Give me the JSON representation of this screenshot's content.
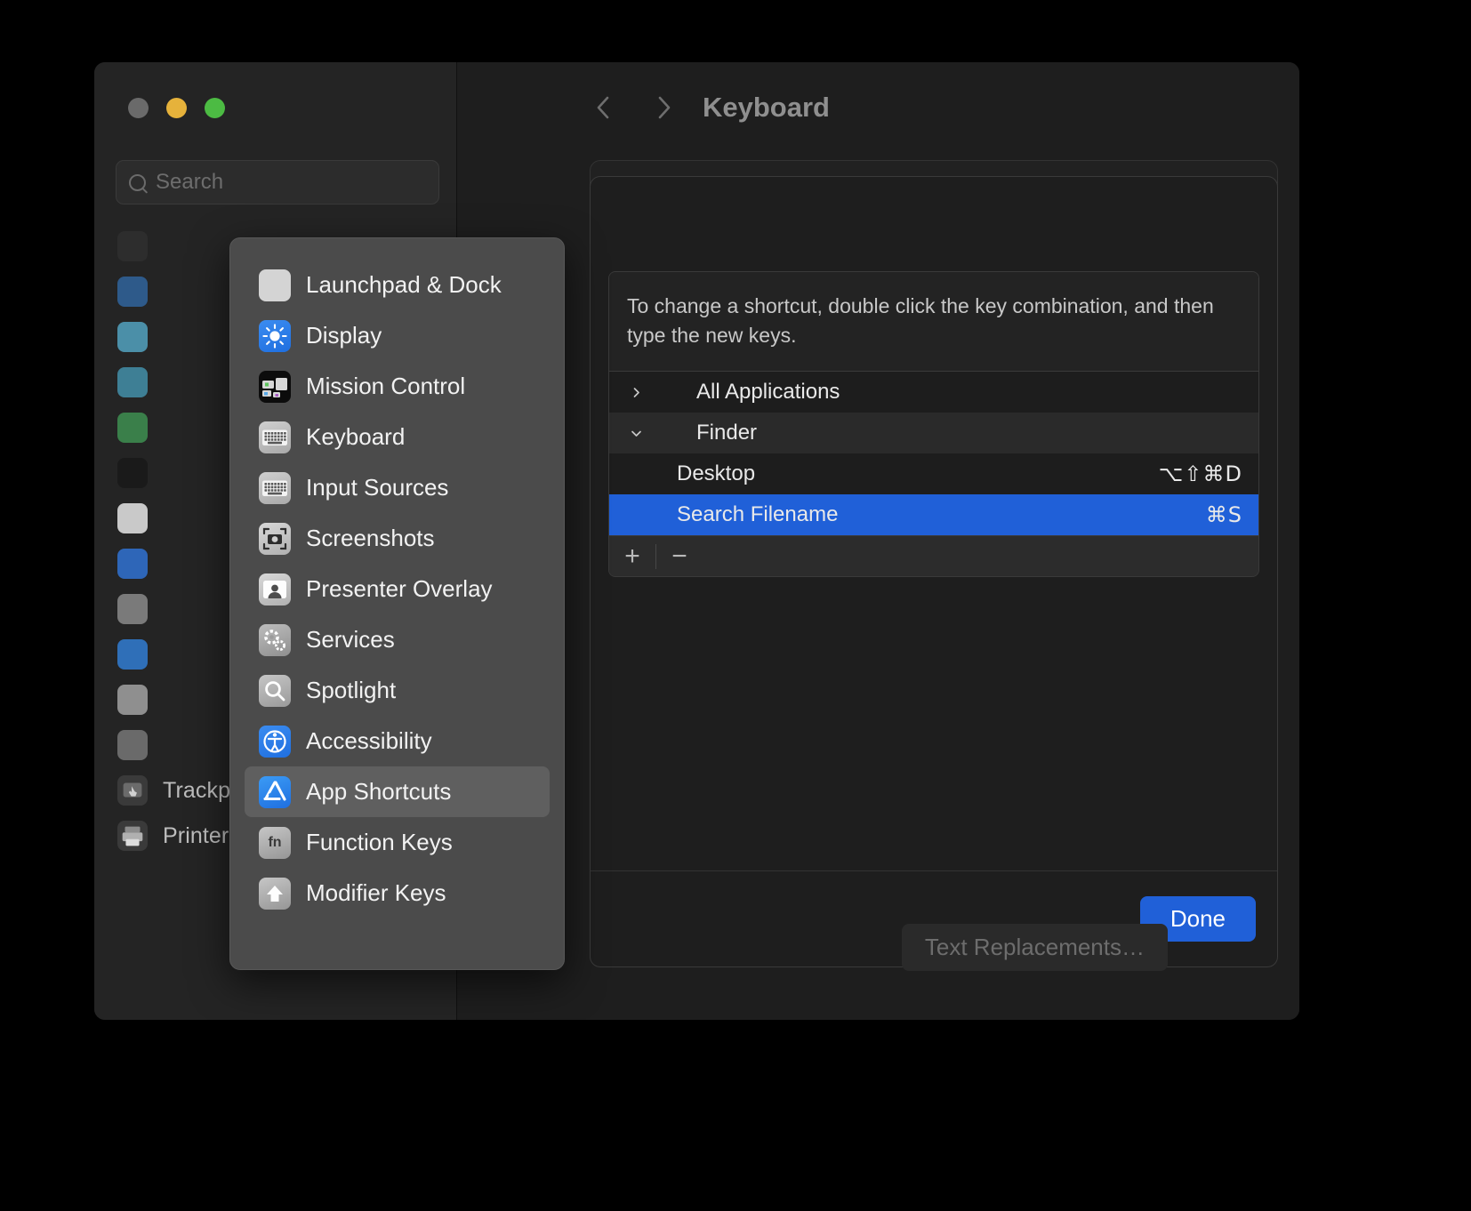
{
  "window": {
    "traffic_lights": [
      "close",
      "minimize",
      "maximize"
    ],
    "title": "Keyboard",
    "back_icon": "chevron-left-icon",
    "forward_icon": "chevron-right-icon"
  },
  "sidebar": {
    "search": {
      "placeholder": "Search",
      "value": "",
      "icon": "search-icon"
    },
    "hidden_items": [
      {
        "icon": "generic"
      },
      {
        "icon": "generic"
      },
      {
        "icon": "generic"
      },
      {
        "icon": "generic"
      },
      {
        "icon": "generic"
      },
      {
        "icon": "generic"
      },
      {
        "icon": "generic"
      },
      {
        "icon": "generic"
      },
      {
        "icon": "generic"
      },
      {
        "icon": "generic"
      },
      {
        "icon": "generic"
      },
      {
        "icon": "generic"
      }
    ],
    "items": [
      {
        "label": "Trackpad",
        "icon": "trackpad-icon"
      },
      {
        "label": "Printers & Scanners",
        "icon": "printer-icon"
      }
    ]
  },
  "popover": {
    "items": [
      {
        "label": "Launchpad & Dock",
        "icon": "launchpad-icon",
        "selected": false
      },
      {
        "label": "Display",
        "icon": "display-icon",
        "selected": false
      },
      {
        "label": "Mission Control",
        "icon": "mission-control-icon",
        "selected": false
      },
      {
        "label": "Keyboard",
        "icon": "keyboard-icon",
        "selected": false
      },
      {
        "label": "Input Sources",
        "icon": "input-sources-icon",
        "selected": false
      },
      {
        "label": "Screenshots",
        "icon": "screenshots-icon",
        "selected": false
      },
      {
        "label": "Presenter Overlay",
        "icon": "presenter-overlay-icon",
        "selected": false
      },
      {
        "label": "Services",
        "icon": "services-icon",
        "selected": false
      },
      {
        "label": "Spotlight",
        "icon": "spotlight-icon",
        "selected": false
      },
      {
        "label": "Accessibility",
        "icon": "accessibility-icon",
        "selected": false
      },
      {
        "label": "App Shortcuts",
        "icon": "app-shortcuts-icon",
        "selected": true
      },
      {
        "label": "Function Keys",
        "icon": "function-keys-icon",
        "selected": false
      },
      {
        "label": "Modifier Keys",
        "icon": "modifier-keys-icon",
        "selected": false
      }
    ]
  },
  "main": {
    "hint": "To change a shortcut, double click the key combination, and then type the new keys.",
    "rows": [
      {
        "type": "group",
        "label": "All Applications",
        "expanded": false,
        "disclosure": "chevron-right-icon",
        "keys": ""
      },
      {
        "type": "group",
        "label": "Finder",
        "expanded": true,
        "disclosure": "chevron-down-icon",
        "keys": ""
      },
      {
        "type": "child",
        "label": "Desktop",
        "keys": "⌥⇧⌘D",
        "selected": false
      },
      {
        "type": "child",
        "label": "Search Filename",
        "keys": "⌘S",
        "selected": true
      }
    ],
    "footer": {
      "add_label": "+",
      "remove_label": "−"
    },
    "done_label": "Done",
    "text_replacements_label": "Text Replacements…"
  },
  "colors": {
    "accent": "#2060d8",
    "selection": "#2060d8",
    "window_bg": "#1e1e1e",
    "sidebar_bg": "#242424",
    "popover_bg": "#4b4b4b"
  }
}
